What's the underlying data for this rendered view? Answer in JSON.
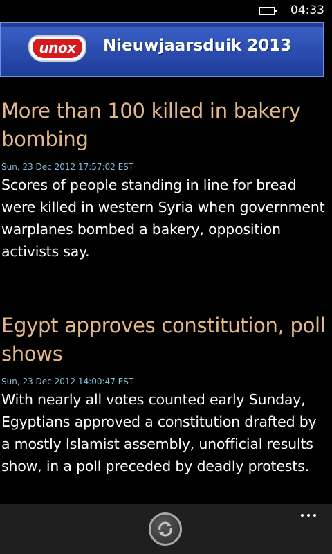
{
  "status_bar": {
    "time": "04:33",
    "battery_icon": "battery-icon"
  },
  "ad": {
    "brand": "unox",
    "text": "Nieuwjaarsduik 2013",
    "colors": {
      "background": "#2a4db5",
      "logo_red": "#d5191c"
    }
  },
  "articles": [
    {
      "title": "More than 100 killed in bakery bombing",
      "date": "Sun, 23 Dec 2012 17:57:02 EST",
      "summary": "Scores of people standing in line for bread were killed in western Syria when government warplanes bombed a bakery, opposition activists say."
    },
    {
      "title": "Egypt approves constitution, poll shows",
      "date": "Sun, 23 Dec 2012 14:00:47 EST",
      "summary": "With nearly all votes counted early Sunday, Egyptians approved a constitution drafted by a mostly Islamist assembly, unofficial results show, in a poll preceded by deadly protests."
    }
  ],
  "app_bar": {
    "refresh_icon": "refresh-icon",
    "more_icon": "more-icon"
  },
  "colors": {
    "title": "#e3b888",
    "date": "#86bdd6",
    "summary": "#ffffff",
    "background": "#000000",
    "app_bar": "#1f1f1f"
  }
}
